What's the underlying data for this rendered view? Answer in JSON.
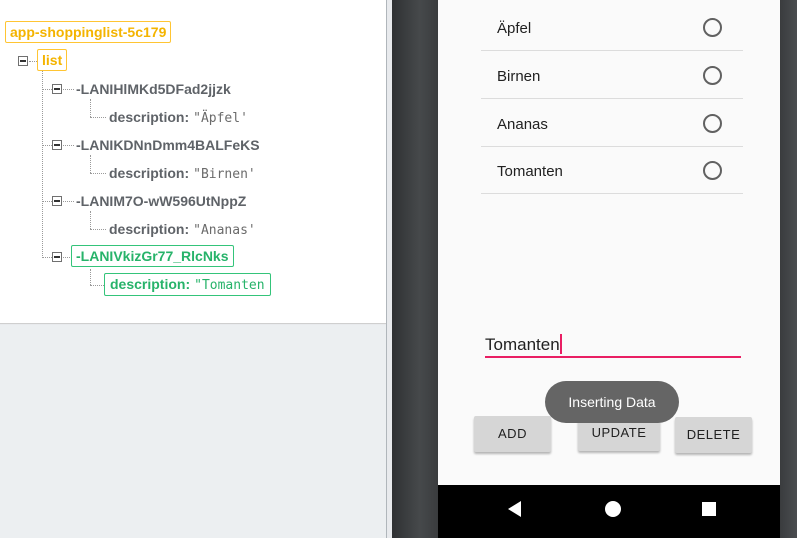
{
  "firebase_tree": {
    "root": "app-shoppinglist-5c179",
    "list": "list",
    "entries": [
      {
        "key": "-LANIHlMKd5DFad2jjzk",
        "description_label": "description:",
        "description_value": "\"Äpfel'"
      },
      {
        "key": "-LANIKDNnDmm4BALFeKS",
        "description_label": "description:",
        "description_value": "\"Birnen'"
      },
      {
        "key": "-LANIM7O-wW596UtNppZ",
        "description_label": "description:",
        "description_value": "\"Ananas'"
      },
      {
        "key": "-LANIVkizGr77_RlcNks",
        "description_label": "description:",
        "description_value": "\"Tomanten"
      }
    ]
  },
  "app": {
    "items": [
      {
        "label": "Äpfel"
      },
      {
        "label": "Birnen"
      },
      {
        "label": "Ananas"
      },
      {
        "label": "Tomanten"
      }
    ],
    "input_value": "Tomanten",
    "toast": "Inserting Data",
    "buttons": {
      "add": "ADD",
      "update": "UPDATE",
      "delete": "DELETE"
    }
  },
  "colors": {
    "root_highlight": "#f4b400",
    "new_entry_highlight": "#27b36a",
    "input_accent": "#e91e63"
  },
  "icons": {
    "nav_back": "back-triangle-icon",
    "nav_home": "home-circle-icon",
    "nav_recents": "recents-square-icon"
  }
}
